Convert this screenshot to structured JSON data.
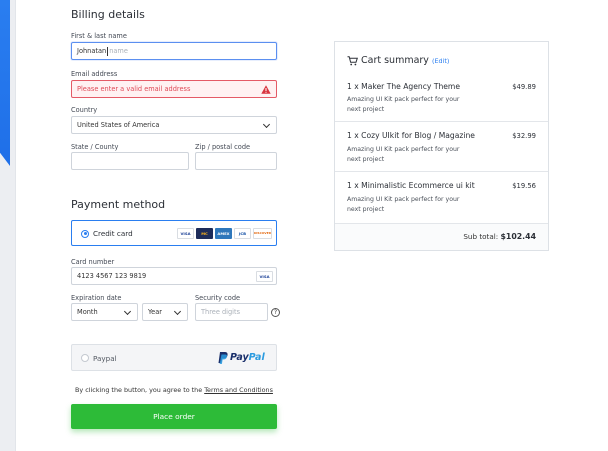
{
  "billing": {
    "title": "Billing details",
    "name_label": "First & last name",
    "name_value": "Johnatan",
    "name_placeholder": "name",
    "email_label": "Email address",
    "email_error": "Please enter a valid email address",
    "country_label": "Country",
    "country_value": "United States of America",
    "state_label": "State / County",
    "zip_label": "Zip / postal code"
  },
  "payment": {
    "title": "Payment method",
    "credit_label": "Credit card",
    "card_logos": [
      "VISA",
      "MC",
      "AMEX",
      "JCB",
      "DISCOVER"
    ],
    "card_number_label": "Card number",
    "card_number_value": "4123 4567 123 9819",
    "card_number_logo": "VISA",
    "expiration_label": "Expiration date",
    "month_value": "Month",
    "year_value": "Year",
    "security_label": "Security code",
    "security_placeholder": "Three digits",
    "help_icon": "?",
    "paypal_label": "Paypal",
    "paypal_logo_a": "Pay",
    "paypal_logo_b": "Pal",
    "terms_prefix": "By clicking the button, you agree to the ",
    "terms_link": "Terms and Conditions",
    "place_order": "Place order"
  },
  "cart": {
    "title": "Cart summary",
    "edit": "(Edit)",
    "items": [
      {
        "title": "1 x Maker The Agency Theme",
        "price": "$49.89",
        "desc": "Amazing UI Kit pack perfect for your next project"
      },
      {
        "title": "1 x Cozy UIkit for Blog / Magazine",
        "price": "$32.99",
        "desc": "Amazing UI Kit pack perfect for your next project"
      },
      {
        "title": "1 x Minimalistic Ecommerce ui kit",
        "price": "$19.56",
        "desc": "Amazing UI Kit pack perfect for your next project"
      }
    ],
    "subtotal_label": "Sub total:",
    "subtotal_value": "$102.44"
  },
  "colors": {
    "accent": "#2a7ef0",
    "success": "#2dbb38",
    "error": "#e45a66"
  }
}
